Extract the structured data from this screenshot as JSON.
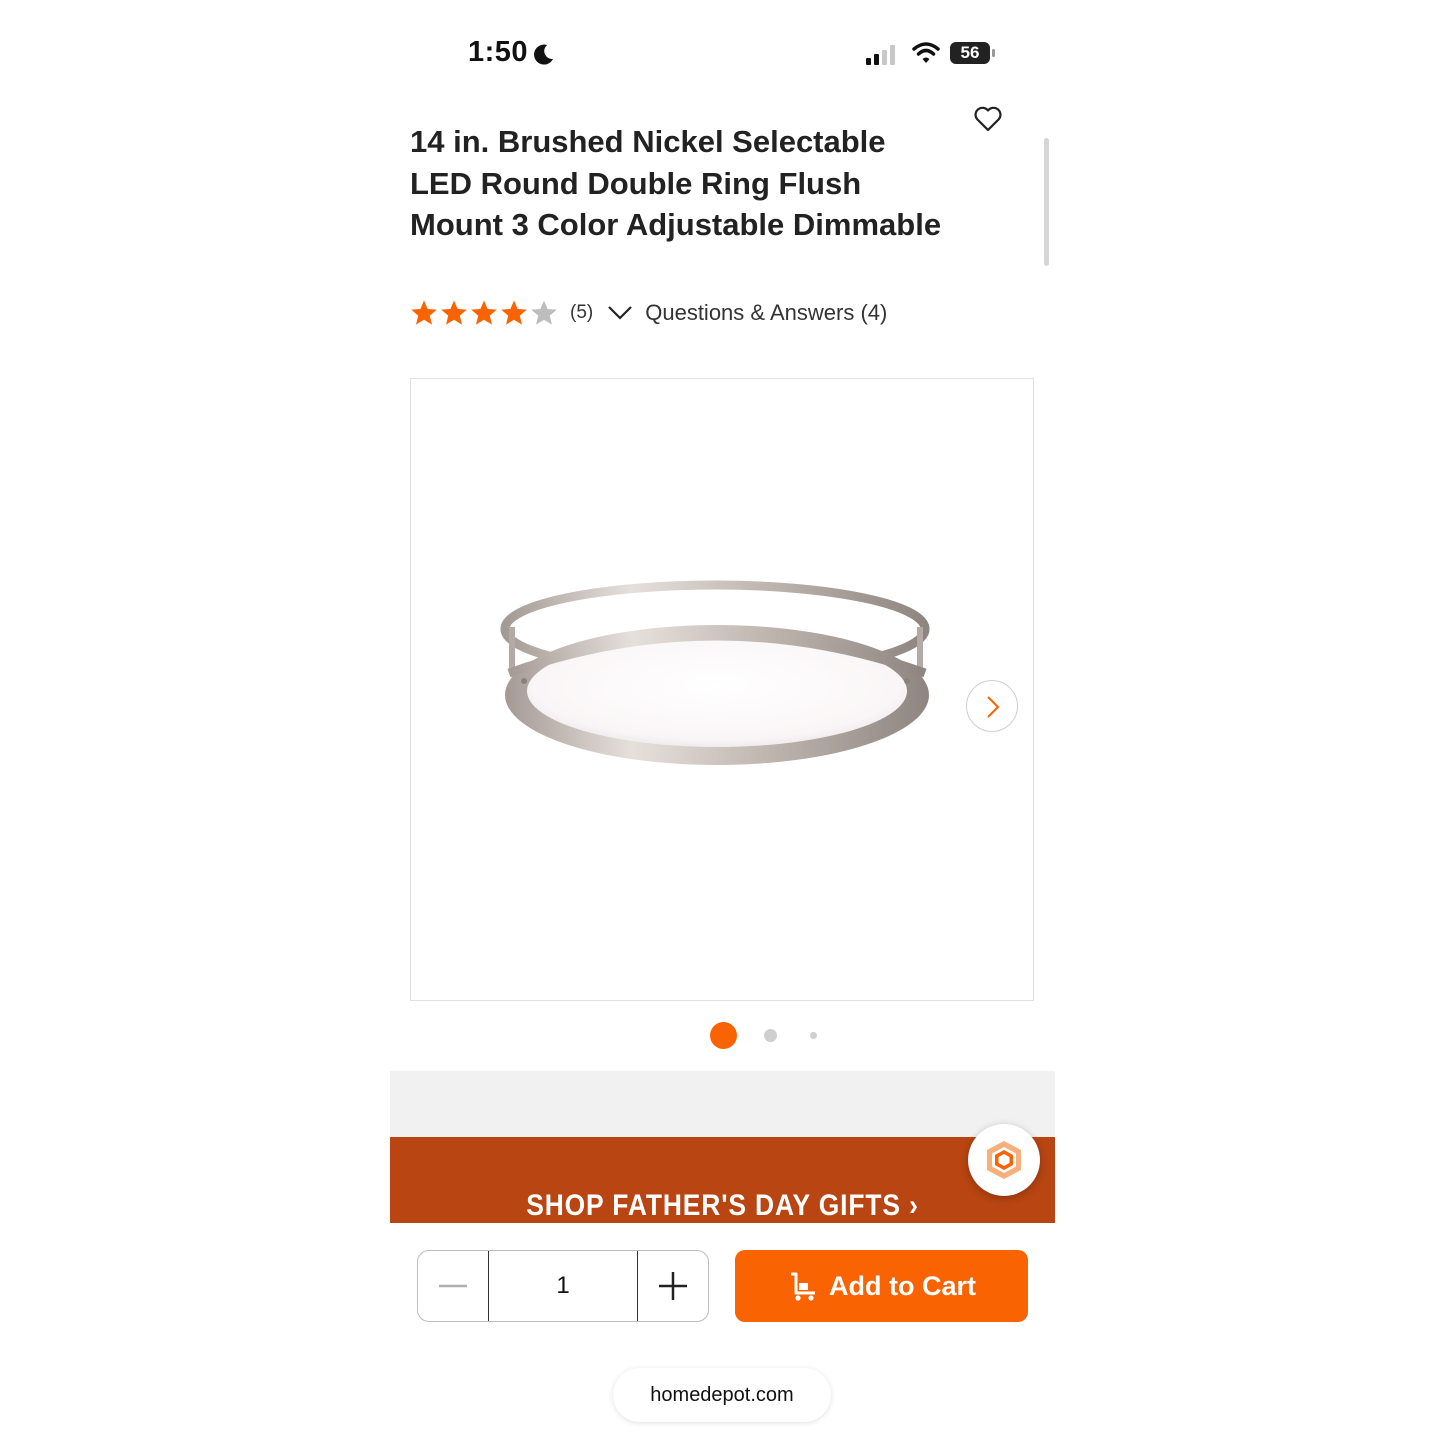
{
  "status_bar": {
    "time": "1:50",
    "battery": "56"
  },
  "product": {
    "title": "14 in. Brushed Nickel Selectable LED Round Double Ring Flush Mount 3 Color Adjustable Dimmable",
    "rating": 4,
    "rating_max": 5,
    "review_count": "(5)",
    "qa_label": "Questions & Answers (4)"
  },
  "gallery": {
    "image_count": 3,
    "active_index": 0
  },
  "banner": {
    "text": "SHOP FATHER'S DAY GIFTS ›"
  },
  "cart": {
    "quantity": "1",
    "add_label": "Add to Cart"
  },
  "browser": {
    "url": "homedepot.com"
  },
  "colors": {
    "accent": "#f96302",
    "banner": "#b84512",
    "star_filled": "#f96302",
    "star_empty": "#bdbdbd"
  },
  "icons": [
    "moon-icon",
    "signal-icon",
    "wifi-icon",
    "heart-icon",
    "star-icon",
    "chevron-down-icon",
    "chevron-right-icon",
    "minus-icon",
    "plus-icon",
    "cart-icon",
    "chat-icon"
  ]
}
